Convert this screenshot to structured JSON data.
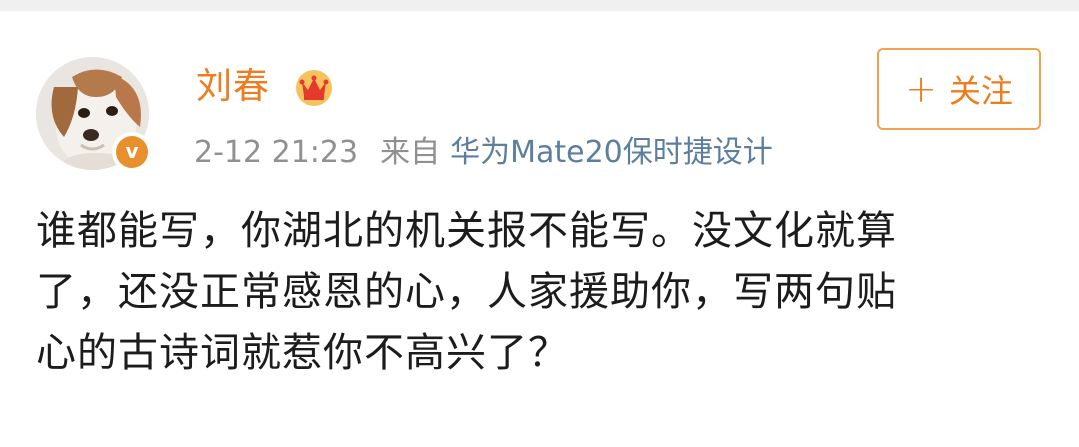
{
  "post": {
    "author": "刘春",
    "author_badge_icon": "crown-icon",
    "verified_badge_icon": "verified-v-icon",
    "verified_mark": "v",
    "timestamp": "2-12 21:23",
    "source_prefix": "来自",
    "source_device": "华为Mate20保时捷设计",
    "follow_button": {
      "icon": "plus-icon",
      "plus": "+",
      "label": "关注"
    },
    "content_lines": [
      "谁都能写，你湖北的机关报不能写。没文化就算",
      "了，还没正常感恩的心，人家援助你，写两句贴",
      "心的古诗词就惹你不高兴了？"
    ]
  },
  "colors": {
    "name": "#ed7d1e",
    "device_link": "#5c7e9f",
    "meta": "#909090",
    "follow_border": "#f1a24b",
    "verified_badge": "#e8902e"
  }
}
